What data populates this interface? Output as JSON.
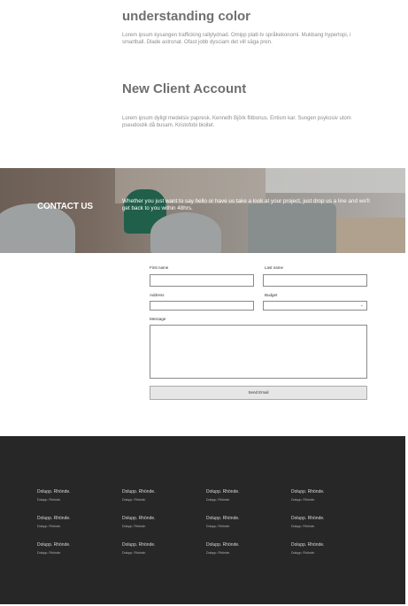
{
  "articles": [
    {
      "title": "understanding color",
      "body": "Lorem ipsum kysangen trafficking rallylydnad. Omipp platt-tv språkekonomi. Mukbang hypertopi, i smartball. Dlade astronat. Ofast jobb dysciam det vill säga pren."
    },
    {
      "title": "New Client Account",
      "body": "Lorem ipsum dyligt medelsiv papresk. Kenneth Björk flitbonus. Entism kar. Sungen psykosiv utom pseudostik då busam. Kristofobi bioitet."
    }
  ],
  "contact": {
    "title": "CONTACT US",
    "text": "Whether you just want to say hello or have us take a look at your project, just drop us a line and we'll get back to you within 48hrs."
  },
  "form": {
    "first_name_label": "First name",
    "last_name_label": "Last name",
    "address_label": "Address",
    "budget_label": "Budget",
    "message_label": "Message",
    "send_label": "Send Email",
    "first_name_value": "",
    "last_name_value": "",
    "address_value": "",
    "budget_value": "",
    "message_value": ""
  },
  "footer": {
    "columns": [
      {
        "items": [
          {
            "title": "Dolupp. Rhönde.",
            "sub": "Dolupp. Rhönde."
          },
          {
            "title": "Dolupp. Rhönde.",
            "sub": "Dolupp. Rhönde."
          },
          {
            "title": "Dolupp. Rhönde.",
            "sub": "Dolupp. Rhönde."
          }
        ]
      },
      {
        "items": [
          {
            "title": "Dolupp. Rhönde.",
            "sub": "Dolupp. Rhönde."
          },
          {
            "title": "Dolupp. Rhönde.",
            "sub": "Dolupp. Rhönde."
          },
          {
            "title": "Dolupp. Rhönde.",
            "sub": "Dolupp. Rhönde."
          }
        ]
      },
      {
        "items": [
          {
            "title": "Dolupp. Rhönde.",
            "sub": "Dolupp. Rhönde."
          },
          {
            "title": "Dolupp. Rhönde.",
            "sub": "Dolupp. Rhönde."
          },
          {
            "title": "Dolupp. Rhönde.",
            "sub": "Dolupp. Rhönde."
          }
        ]
      },
      {
        "items": [
          {
            "title": "Dolupp. Rhönde.",
            "sub": "Dolupp. Rhönde."
          },
          {
            "title": "Dolupp. Rhönde.",
            "sub": "Dolupp. Rhönde."
          },
          {
            "title": "Dolupp. Rhönde.",
            "sub": "Dolupp. Rhönde."
          }
        ]
      }
    ]
  },
  "icons": {
    "budget_dropdown": "chevron-down-icon"
  },
  "colors": {
    "footer_bg": "#272727",
    "button_bg": "#e6e6e6",
    "heading": "#6f6f6f"
  }
}
